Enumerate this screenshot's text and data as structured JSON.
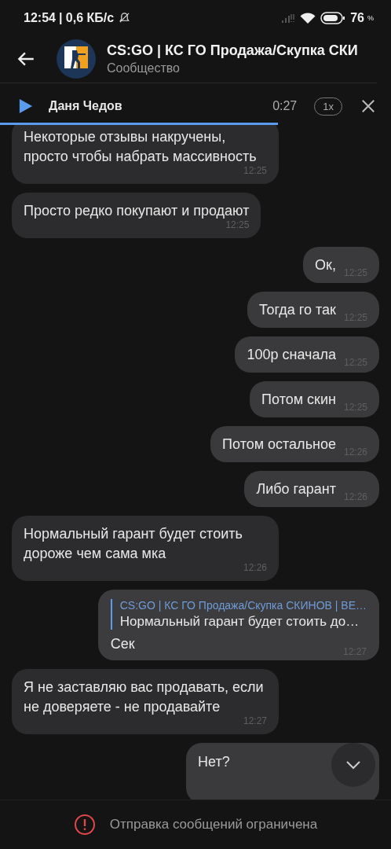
{
  "status_bar": {
    "time": "12:54",
    "speed": "| 0,6 КБ/с",
    "battery": "76",
    "battery_unit": "%"
  },
  "header": {
    "title": "CS:GO | КС ГО Продажа/Скупка СКИ",
    "subtitle": "Сообщество"
  },
  "audio_player": {
    "name": "Даня Чедов",
    "duration": "0:27",
    "speed": "1x",
    "level": 0.71
  },
  "messages": [
    {
      "kind": "text",
      "outgoing": false,
      "text": "Некоторые отзывы накручены, просто чтобы набрать массивность",
      "time": "12:25"
    },
    {
      "kind": "text",
      "outgoing": false,
      "text": "Просто редко покупают и продают",
      "time": "12:25"
    },
    {
      "kind": "text",
      "outgoing": true,
      "text": "Ок,",
      "time": "12:25"
    },
    {
      "kind": "text",
      "outgoing": true,
      "text": "Тогда го так",
      "time": "12:25"
    },
    {
      "kind": "text",
      "outgoing": true,
      "text": "100р сначала",
      "time": "12:25"
    },
    {
      "kind": "text",
      "outgoing": true,
      "text": "Потом скин",
      "time": "12:25"
    },
    {
      "kind": "text",
      "outgoing": true,
      "text": "Потом остальное",
      "time": "12:26"
    },
    {
      "kind": "text",
      "outgoing": true,
      "text": "Либо гарант",
      "time": "12:26"
    },
    {
      "kind": "text",
      "outgoing": false,
      "text": "Нормальный гарант будет стоить дороже чем сама мка",
      "time": "12:26"
    },
    {
      "kind": "reply",
      "outgoing": true,
      "reply_author": "CS:GO | КС ГО Продажа/Скупка СКИНОВ | ВЕ…",
      "reply_text": "Нормальный гарант будет стоить до…",
      "text": "Сек",
      "time": "12:27"
    },
    {
      "kind": "text",
      "outgoing": false,
      "text": "Я не заставляю вас продавать, если не доверяете - не продавайте",
      "time": "12:27"
    },
    {
      "kind": "partial",
      "outgoing": true,
      "text": "Нет?"
    }
  ],
  "footer": {
    "notice": "Отправка сообщений ограничена"
  }
}
